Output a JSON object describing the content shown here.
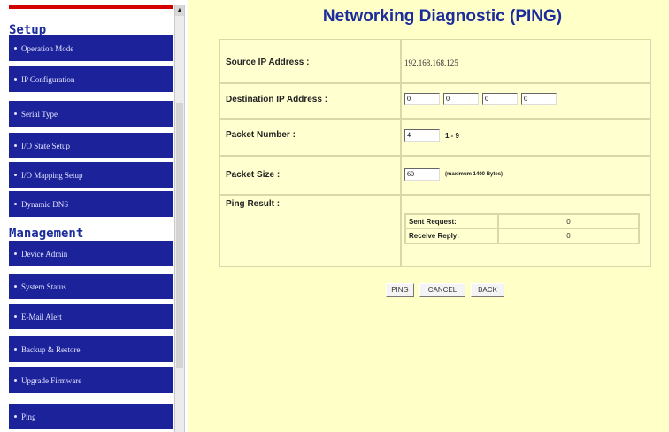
{
  "sidebar": {
    "setup_heading": "Setup",
    "setup_items": [
      {
        "label": "Operation Mode"
      },
      {
        "label": "IP Configuration"
      },
      {
        "label": "Serial Type"
      },
      {
        "label": "I/O State Setup"
      },
      {
        "label": "I/O Mapping Setup"
      },
      {
        "label": "Dynamic DNS"
      }
    ],
    "management_heading": "Management",
    "management_items": [
      {
        "label": "Device Admin"
      },
      {
        "label": "System Status"
      },
      {
        "label": "E-Mail Alert"
      },
      {
        "label": "Backup & Restore"
      },
      {
        "label": "Upgrade Firmware"
      },
      {
        "label": "Ping"
      }
    ]
  },
  "main": {
    "title": "Networking Diagnostic (PING)",
    "source_ip": {
      "label": "Source IP Address :",
      "value": "192.168.168.125"
    },
    "destination_ip": {
      "label": "Destination IP Address :",
      "octets": [
        "0",
        "0",
        "0",
        "0"
      ]
    },
    "packet_number": {
      "label": "Packet Number :",
      "value": "4",
      "unit": "1 - 9"
    },
    "packet_size": {
      "label": "Packet Size :",
      "value": "60",
      "unit": "(maximum 1400 Bytes)"
    },
    "ping_result": {
      "label": "Ping Result :",
      "sent_label": "Sent Request:",
      "sent_value": "0",
      "received_label": "Receive Reply:",
      "received_value": "0"
    },
    "buttons": {
      "ping": "PING",
      "cancel": "CANCEL",
      "back": "BACK"
    }
  }
}
